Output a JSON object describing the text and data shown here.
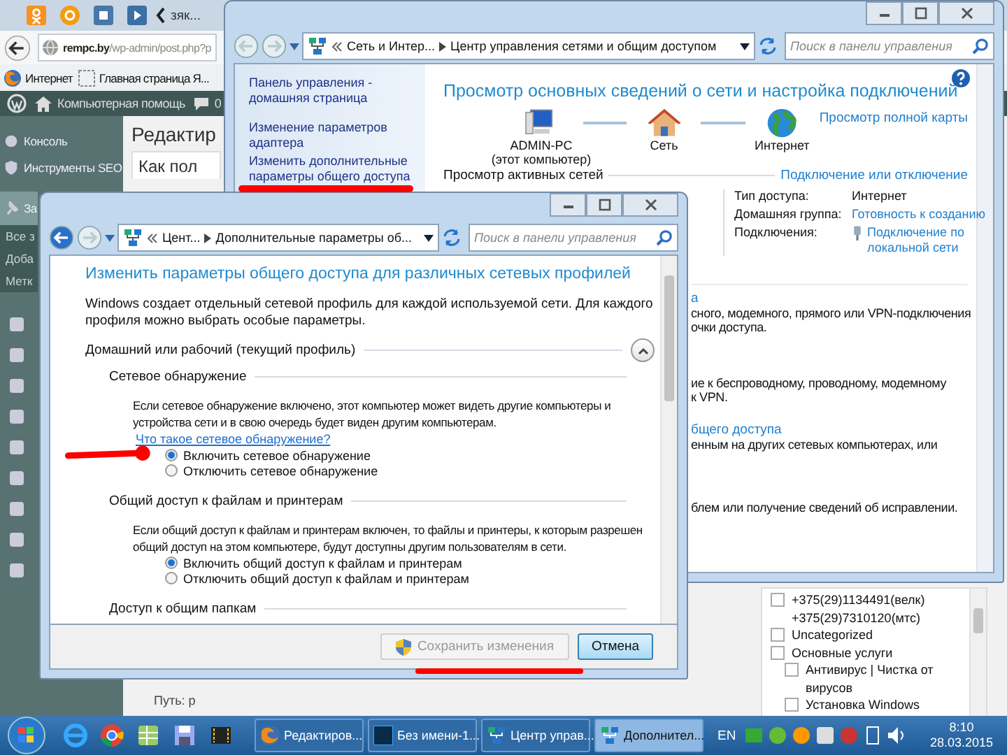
{
  "browser": {
    "tab_title": "зяк...",
    "address": "**rempc.by**/wp-admin/post.php?p",
    "bookmarks": [
      "Интернет",
      "Главная страница Я..."
    ],
    "admin_bar": {
      "site": "Компьютерная помощь",
      "comments": "0"
    },
    "menu": [
      {
        "kind": "main",
        "label": "Консоль",
        "selected": false
      },
      {
        "kind": "main",
        "label": "Инструменты SEO",
        "selected": false
      },
      {
        "kind": "main",
        "label": "За",
        "selected": true
      },
      {
        "kind": "sub",
        "label": "Все з",
        "selected": false
      },
      {
        "kind": "sub",
        "label": "Доба",
        "selected": false
      },
      {
        "kind": "sub",
        "label": "Метк",
        "selected": false
      },
      {
        "kind": "icon",
        "selected": false
      },
      {
        "kind": "icon",
        "selected": false
      },
      {
        "kind": "icon",
        "selected": false
      },
      {
        "kind": "icon",
        "selected": false
      },
      {
        "kind": "icon",
        "selected": false
      },
      {
        "kind": "icon",
        "selected": false
      },
      {
        "kind": "icon",
        "selected": false
      },
      {
        "kind": "icon",
        "selected": false
      },
      {
        "kind": "icon",
        "selected": false
      }
    ],
    "page_title": "Редактир",
    "post_title": "Как пол",
    "path": "Путь: p",
    "categories": [
      {
        "label": "+375(29)1134491(велк) +375(29)7310120(мтс)",
        "checked": false
      },
      {
        "label": "Uncategorized",
        "checked": false
      },
      {
        "label": "Основные услуги",
        "checked": false,
        "children": [
          {
            "label": "Антивирус | Чистка от вирусов",
            "checked": false
          },
          {
            "label": "Установка Windows",
            "checked": false
          }
        ]
      }
    ]
  },
  "network_center": {
    "breadcrumb": [
      "Сеть и Интер...",
      "Центр управления сетями и общим доступом"
    ],
    "search_placeholder": "Поиск в панели управления",
    "links": [
      "Панель управления - домашняя страница",
      "Изменение параметров адаптера",
      "Изменить дополнительные параметры общего доступа"
    ],
    "title": "Просмотр основных сведений о сети и настройка подключений",
    "map": [
      {
        "kind": "computer",
        "label": "ADMIN-PC",
        "sublabel": "(этот компьютер)"
      },
      {
        "kind": "house",
        "label": "Сеть"
      },
      {
        "kind": "globe",
        "label": "Интернет"
      }
    ],
    "full_map_link": "Просмотр полной карты",
    "active_heading": "Просмотр активных сетей",
    "connect_link": "Подключение или отключение",
    "properties": [
      {
        "label": "Тип доступа:",
        "value": "Интернет",
        "kind": "text"
      },
      {
        "label": "Домашняя группа:",
        "value": "Готовность к созданию",
        "kind": "link"
      },
      {
        "label": "Подключения:",
        "value": "Подключение по локальной сети",
        "kind": "connection"
      }
    ],
    "fragments": [
      {
        "link": "а",
        "text": "сного, модемного, прямого или VPN-подключения\nочки доступа."
      },
      {
        "text": "ие к беспроводному, проводному, модемному\nк VPN."
      },
      {
        "link": "бщего доступа",
        "text": "енным на других сетевых компьютерах, или"
      },
      {
        "text": "блем или получение сведений об исправлении."
      }
    ]
  },
  "sharing_window": {
    "breadcrumb": [
      "Цент...",
      "Дополнительные параметры об..."
    ],
    "search_placeholder": "Поиск в панели управления",
    "title": "Изменить параметры общего доступа для различных сетевых профилей",
    "intro": "Windows создает отдельный сетевой профиль для каждой используемой сети. Для каждого профиля можно выбрать особые параметры.",
    "profile": {
      "label": "Домашний или рабочий (текущий профиль)",
      "expanded": true
    },
    "sections": [
      {
        "heading": "Сетевое обнаружение",
        "description": "Если сетевое обнаружение включено, этот компьютер может видеть другие компьютеры и устройства сети и в свою очередь будет виден другим компьютерам.",
        "link": "Что такое сетевое обнаружение?",
        "options": [
          {
            "label": "Включить сетевое обнаружение",
            "selected": true
          },
          {
            "label": "Отключить сетевое обнаружение",
            "selected": false
          }
        ]
      },
      {
        "heading": "Общий доступ к файлам и принтерам",
        "description": "Если общий доступ к файлам и принтерам включен, то файлы и принтеры, к которым разрешен общий доступ на этом компьютере, будут доступны другим пользователям в сети.",
        "options": [
          {
            "label": "Включить общий доступ к файлам и принтерам",
            "selected": true
          },
          {
            "label": "Отключить общий доступ к файлам и принтерам",
            "selected": false
          }
        ]
      },
      {
        "heading": "Доступ к общим папкам"
      }
    ],
    "buttons": [
      {
        "label": "Сохранить изменения",
        "disabled": true,
        "kind": "shield"
      },
      {
        "label": "Отмена",
        "disabled": false,
        "kind": "plain"
      }
    ]
  },
  "taskbar": {
    "tasks": [
      {
        "kind": "firefox",
        "label": "Редактиров...",
        "selected": false
      },
      {
        "kind": "photoshop",
        "label": "Без имени-1...",
        "selected": false
      },
      {
        "kind": "network",
        "label": "Центр управ...",
        "selected": false
      },
      {
        "kind": "network",
        "label": "Дополнител...",
        "selected": true
      }
    ],
    "language": "EN",
    "time": "8:10",
    "date": "28.03.2015"
  }
}
